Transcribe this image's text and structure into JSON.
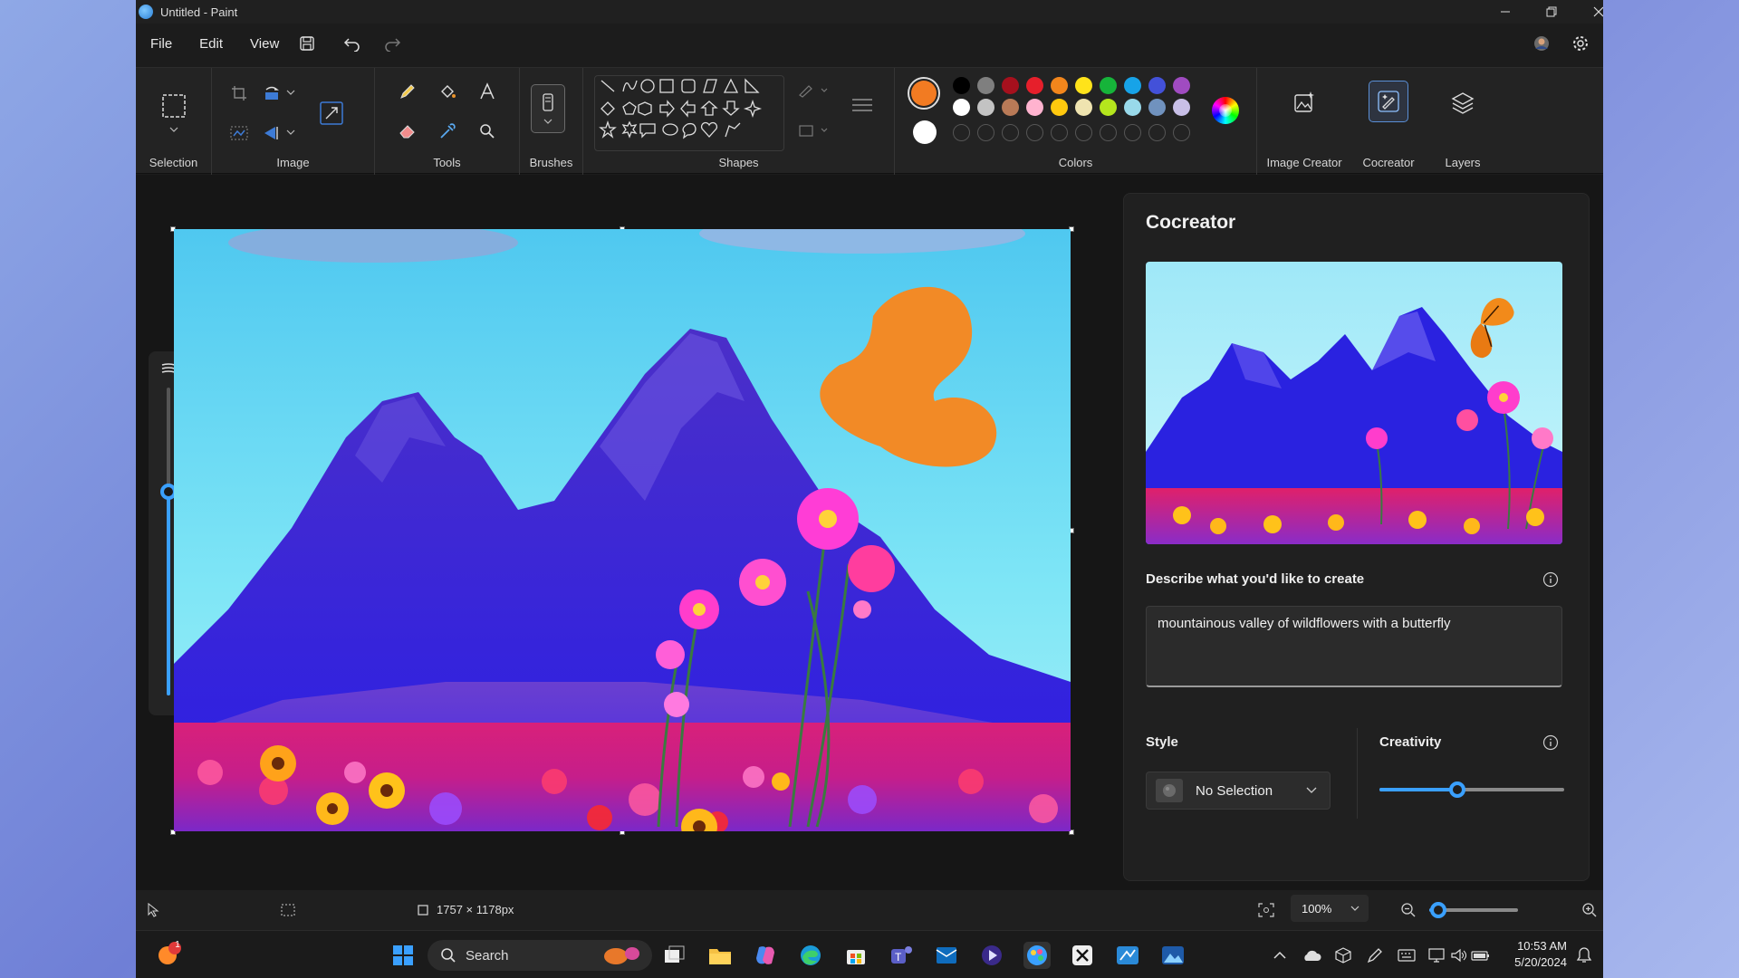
{
  "window": {
    "title": "Untitled - Paint"
  },
  "menu": {
    "file": "File",
    "edit": "Edit",
    "view": "View"
  },
  "ribbon": {
    "selection": "Selection",
    "image": "Image",
    "tools": "Tools",
    "brushes": "Brushes",
    "shapes": "Shapes",
    "colors": "Colors",
    "image_creator": "Image Creator",
    "cocreator": "Cocreator",
    "layers": "Layers"
  },
  "colors": {
    "primary": "#f27b22",
    "secondary": "#ffffff",
    "palette_row1": [
      "#000000",
      "#7f7f7f",
      "#a6101d",
      "#e61f2b",
      "#f2861c",
      "#ffe31a",
      "#16b43a",
      "#17a3e8",
      "#4351d9",
      "#a04bc1"
    ],
    "palette_row2": [
      "#ffffff",
      "#c3c3c3",
      "#b97a57",
      "#ffb3cf",
      "#ffc90e",
      "#efe4b0",
      "#b5e61d",
      "#99d9ea",
      "#7092be",
      "#c8bfe7"
    ]
  },
  "cocreator": {
    "title": "Cocreator",
    "describe_label": "Describe what you'd like to create",
    "prompt": "mountainous valley of wildflowers with a butterfly",
    "style_label": "Style",
    "style_value": "No Selection",
    "creativity_label": "Creativity",
    "creativity_value": 0.42
  },
  "status": {
    "dimensions": "1757 × 1178px",
    "zoom": "100%",
    "zoom_slider": 0.1
  },
  "taskbar": {
    "search": "Search",
    "notification_count": "1",
    "time": "10:53 AM",
    "date": "5/20/2024"
  }
}
